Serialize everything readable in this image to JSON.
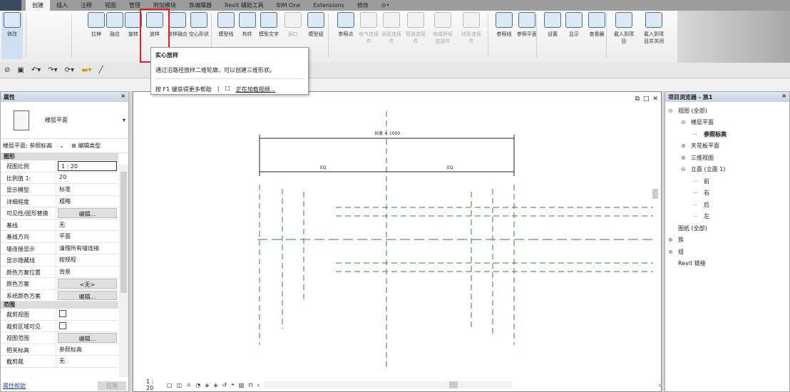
{
  "tabs": [
    "创建",
    "插入",
    "注释",
    "视图",
    "管理",
    "附加模块",
    "族编辑器",
    "Revit 辅助工具",
    "BIM One",
    "Extensions",
    "修改",
    "⊙•"
  ],
  "active_tab": "创建",
  "ribbon": {
    "buttons": [
      "修改",
      "拉伸",
      "融合",
      "旋转",
      "放样",
      "放样融合",
      "空心形状",
      "模型线",
      "构件",
      "模型文字",
      "洞口",
      "模型组",
      "参照点",
      "电气连接件",
      "风管连接件",
      "管道连接件",
      "电缆桥架连接件",
      "线管连接件",
      "参照线",
      "参照平面",
      "设置",
      "显示",
      "查看器",
      "载入到项目",
      "载入到项目并关闭"
    ]
  },
  "tooltip": {
    "title": "实心放样",
    "description": "通过沿路径放样二维轮廓，可以创建三维形状。",
    "help": "按 F1 键获得更多帮助",
    "video": "正在加载视频..."
  },
  "properties": {
    "title": "属性",
    "close": "×",
    "type_name": "楼层平面",
    "selector": "楼层平面: 参照标高",
    "edit_type": "编辑类型",
    "groups": [
      {
        "name": "图形",
        "rows": [
          {
            "k": "视图比例",
            "v": "1 : 20",
            "style": "box"
          },
          {
            "k": "比例值 1:",
            "v": "20"
          },
          {
            "k": "显示模型",
            "v": "标准"
          },
          {
            "k": "详细程度",
            "v": "粗略"
          },
          {
            "k": "可见性/图形替换",
            "v": "编辑...",
            "style": "btn"
          },
          {
            "k": "基线",
            "v": "无"
          },
          {
            "k": "基线方向",
            "v": "平面"
          },
          {
            "k": "墙连接显示",
            "v": "清理所有墙连接"
          },
          {
            "k": "显示隐藏线",
            "v": "按规程"
          },
          {
            "k": "颜色方案位置",
            "v": "背景"
          },
          {
            "k": "颜色方案",
            "v": "<无>",
            "style": "btn"
          },
          {
            "k": "系统颜色方案",
            "v": "编辑...",
            "style": "btn"
          }
        ]
      },
      {
        "name": "范围",
        "rows": [
          {
            "k": "裁剪视图",
            "v": "",
            "style": "chk"
          },
          {
            "k": "裁剪区域可见",
            "v": "",
            "style": "chk"
          },
          {
            "k": "视图范围",
            "v": "编辑...",
            "style": "btn"
          },
          {
            "k": "相关标高",
            "v": "参照标高"
          },
          {
            "k": "截剪裁",
            "v": "无"
          }
        ]
      }
    ],
    "help_link": "属性帮助",
    "apply": "应用"
  },
  "canvas": {
    "dimension_total": "长度 = 1000",
    "dimension_eq_left": "EQ",
    "dimension_eq_right": "EQ",
    "scale": "1 : 20",
    "line_color": "#2e8b2e"
  },
  "browser": {
    "title": "项目浏览器 - 族1",
    "close": "×",
    "items": [
      {
        "label": "视图 (全部)",
        "lvl": 0,
        "ex": "⊖"
      },
      {
        "label": "楼层平面",
        "lvl": 1,
        "ex": "⊖"
      },
      {
        "label": "参照标高",
        "lvl": 2,
        "ex": "",
        "sel": true
      },
      {
        "label": "天花板平面",
        "lvl": 1,
        "ex": "⊕"
      },
      {
        "label": "三维视图",
        "lvl": 1,
        "ex": "⊕"
      },
      {
        "label": "立面 (立面 1)",
        "lvl": 1,
        "ex": "⊖"
      },
      {
        "label": "前",
        "lvl": 2,
        "ex": ""
      },
      {
        "label": "右",
        "lvl": 2,
        "ex": ""
      },
      {
        "label": "后",
        "lvl": 2,
        "ex": ""
      },
      {
        "label": "左",
        "lvl": 2,
        "ex": ""
      },
      {
        "label": "图纸 (全部)",
        "lvl": 0,
        "ex": ""
      },
      {
        "label": "族",
        "lvl": 0,
        "ex": "⊕"
      },
      {
        "label": "组",
        "lvl": 0,
        "ex": "⊕"
      },
      {
        "label": "Revit 链接",
        "lvl": 0,
        "ex": ""
      }
    ]
  }
}
